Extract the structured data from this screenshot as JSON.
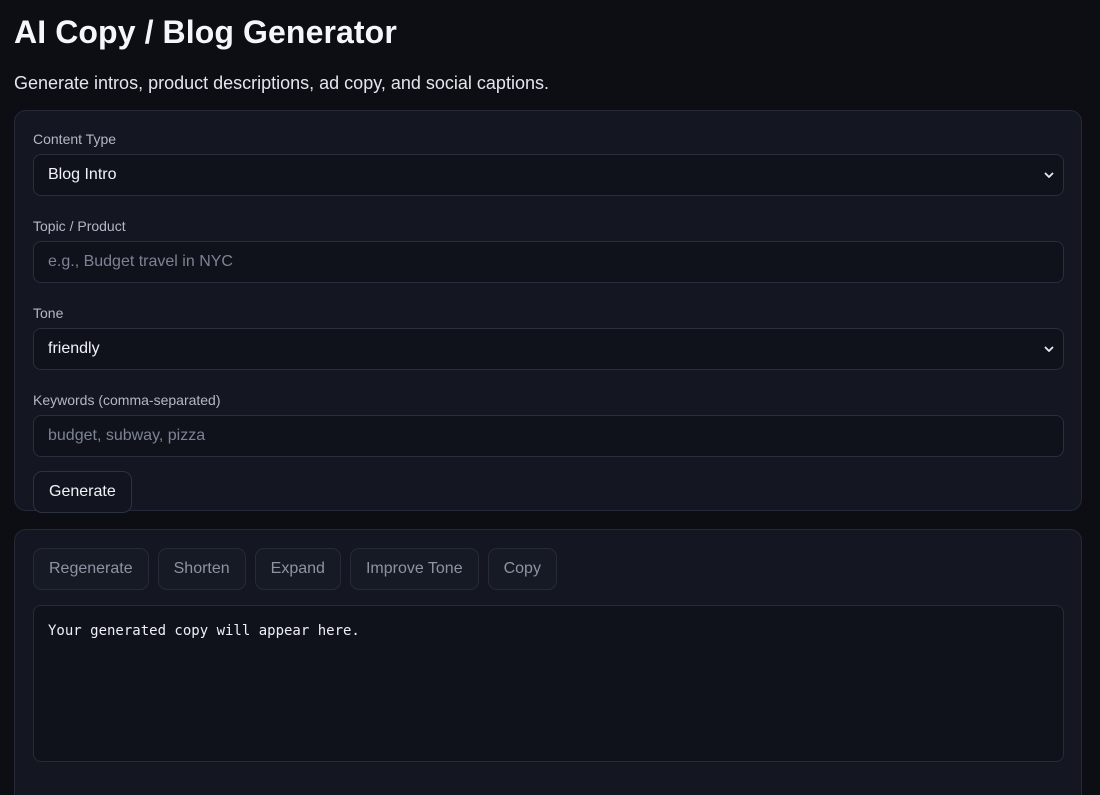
{
  "header": {
    "title": "AI Copy / Blog Generator",
    "subtitle": "Generate intros, product descriptions, ad copy, and social captions."
  },
  "form": {
    "content_type": {
      "label": "Content Type",
      "value": "Blog Intro"
    },
    "topic": {
      "label": "Topic / Product",
      "value": "",
      "placeholder": "e.g., Budget travel in NYC"
    },
    "tone": {
      "label": "Tone",
      "value": "friendly"
    },
    "keywords": {
      "label": "Keywords (comma-separated)",
      "value": "",
      "placeholder": "budget, subway, pizza"
    },
    "generate_label": "Generate"
  },
  "output": {
    "actions": {
      "regenerate": "Regenerate",
      "shorten": "Shorten",
      "expand": "Expand",
      "improve_tone": "Improve Tone",
      "copy": "Copy"
    },
    "text": "Your generated copy will appear here."
  },
  "icons": {
    "select_chevron": "chevron-down-icon"
  },
  "colors": {
    "background": "#0c0e14",
    "card": "#141722",
    "field": "#0f121b",
    "text": "#e8ebf2",
    "muted_button_text": "#8e93a3"
  }
}
